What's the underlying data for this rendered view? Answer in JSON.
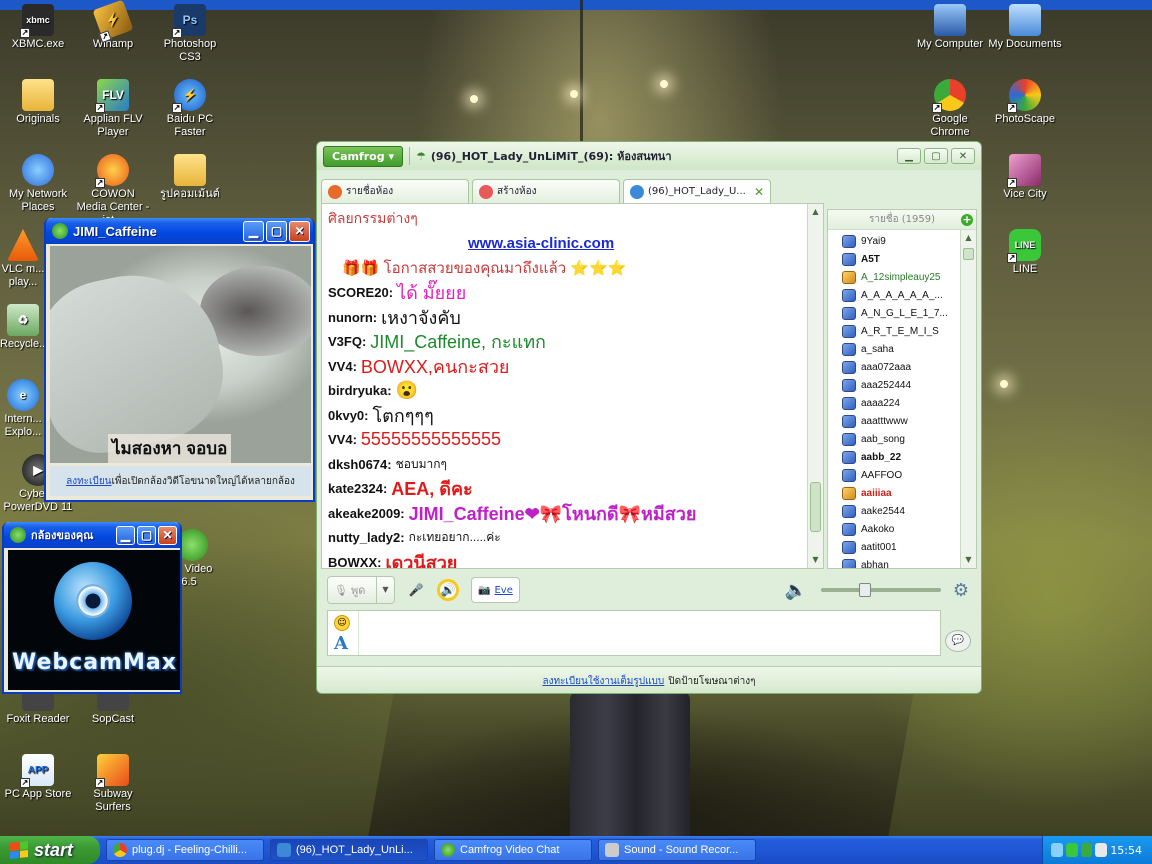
{
  "desktop": {
    "icons": [
      {
        "label": "XBMC.exe"
      },
      {
        "label": "Winamp"
      },
      {
        "label": "Photoshop CS3"
      },
      {
        "label": "Originals"
      },
      {
        "label": "Applian FLV Player"
      },
      {
        "label": "Baidu PC Faster"
      },
      {
        "label": "My Network Places"
      },
      {
        "label": "COWON Media Center - jet..."
      },
      {
        "label": "รูปคอมเม้นต์"
      },
      {
        "label": "VLC m... play..."
      },
      {
        "label": "Recycle..."
      },
      {
        "label": "Intern... Explo..."
      },
      {
        "label": "Cyber... PowerDVD 11"
      },
      {
        "label": "...og Video ...at 6.5"
      },
      {
        "label": "Foxit Reader"
      },
      {
        "label": "SopCast"
      },
      {
        "label": "PC App Store"
      },
      {
        "label": "Subway Surfers"
      },
      {
        "label": "My Computer"
      },
      {
        "label": "My Documents"
      },
      {
        "label": "Google Chrome"
      },
      {
        "label": "PhotoScape"
      },
      {
        "label": "Vice City"
      },
      {
        "label": "LINE"
      }
    ]
  },
  "camfrog": {
    "menu_label": "Camfrog",
    "room_title": "(96)_HOT_Lady_UnLiMiT_(69): ห้องสนทนา",
    "tabs": [
      {
        "label": "รายชื่อห้อง"
      },
      {
        "label": "สร้างห้อง"
      },
      {
        "label": "(96)_HOT_Lady_U...",
        "close": "✕"
      }
    ],
    "chat": [
      {
        "nick": "",
        "msg": "ศิลยกรรมต่างๆ",
        "color": "#c83a3a"
      },
      {
        "nick": "",
        "msg": "www.asia-clinic.com",
        "color": "#1a2ad0"
      },
      {
        "nick": "",
        "msg": "🎁🎁 โอกาสสวยของคุณมาถึงแล้ว ⭐⭐⭐",
        "color": "#c83a3a"
      },
      {
        "nick": "SCORE20:",
        "msg": "ได้ มั๊ยยย",
        "color": "#e020c0"
      },
      {
        "nick": "nunorn:",
        "msg": "เหงาจังคับ",
        "color": "#111111"
      },
      {
        "nick": "V3FQ:",
        "msg": "JIMI_Caffeine, กะแทก",
        "color": "#1a8a2a"
      },
      {
        "nick": "VV4:",
        "msg": "BOWXX,คนกะสวย",
        "color": "#e01a1a"
      },
      {
        "nick": "birdryuka:",
        "msg": "😮",
        "color": "#111111"
      },
      {
        "nick": "0kvy0:",
        "msg": "โตกๆๆๆ",
        "color": "#111111"
      },
      {
        "nick": "VV4:",
        "msg": "55555555555555",
        "color": "#e01a1a"
      },
      {
        "nick": "dksh0674:",
        "msg": "ชอบมากๆ",
        "color": "#111111"
      },
      {
        "nick": "kate2324:",
        "msg": "AEA, ดีคะ",
        "color": "#e01a1a"
      },
      {
        "nick": "akeake2009:",
        "msg": "JIMI_Caffeine❤🎀โหนกดี🎀หมีสวย",
        "color": "#c020c8"
      },
      {
        "nick": "nutty_lady2:",
        "msg": "กะเทยอยาก.....ค่ะ",
        "color": "#111111"
      },
      {
        "nick": "BOWXX:",
        "msg": "เดวนีสวย",
        "color": "#e01a1a"
      }
    ],
    "users_header": "รายชื่อ (1959)",
    "users_add": "+",
    "users": [
      {
        "name": "9Yai9",
        "style": ""
      },
      {
        "name": "A5T",
        "style": "bold"
      },
      {
        "name": "A_12simpleauy25",
        "style": "gold"
      },
      {
        "name": "A_A_A_A_A_A_...",
        "style": ""
      },
      {
        "name": "A_N_G_L_E_1_7...",
        "style": ""
      },
      {
        "name": "A_R_T_E_M_I_S",
        "style": ""
      },
      {
        "name": "a_saha",
        "style": ""
      },
      {
        "name": "aaa072aaa",
        "style": ""
      },
      {
        "name": "aaa252444",
        "style": ""
      },
      {
        "name": "aaaa224",
        "style": ""
      },
      {
        "name": "aaatttwww",
        "style": ""
      },
      {
        "name": "aab_song",
        "style": ""
      },
      {
        "name": "aabb_22",
        "style": "bold"
      },
      {
        "name": "AAFFOO",
        "style": ""
      },
      {
        "name": "aaiiiaa",
        "style": "gold"
      },
      {
        "name": "aake2544",
        "style": ""
      },
      {
        "name": "Aakoko",
        "style": ""
      },
      {
        "name": "aatit001",
        "style": ""
      },
      {
        "name": "abhan",
        "style": ""
      }
    ],
    "talk_label": "พูด",
    "cam_chip_name": "Eve",
    "footer_link": "ลงทะเบียนใช้งานเต็มรูปแบบ",
    "footer_text": "ปิดป้ายโฆษณาต่างๆ"
  },
  "jimi_window": {
    "title": "JIMI_Caffeine",
    "caption": "ไมสองหา จอบอ",
    "reg_link": "ลงทะเบียน",
    "reg_text": "เพื่อเปิดกล้องวิดีโอขนาดใหญ่ได้หลายกล้อง"
  },
  "mycam_window": {
    "title": "กล้องของคุณ",
    "brand": "WebcamMax"
  },
  "taskbar": {
    "start_label": "start",
    "items": [
      {
        "label": "plug.dj - Feeling-Chilli..."
      },
      {
        "label": "(96)_HOT_Lady_UnLi..."
      },
      {
        "label": "Camfrog Video Chat"
      },
      {
        "label": "Sound - Sound Recor..."
      }
    ],
    "clock": "15:54"
  }
}
